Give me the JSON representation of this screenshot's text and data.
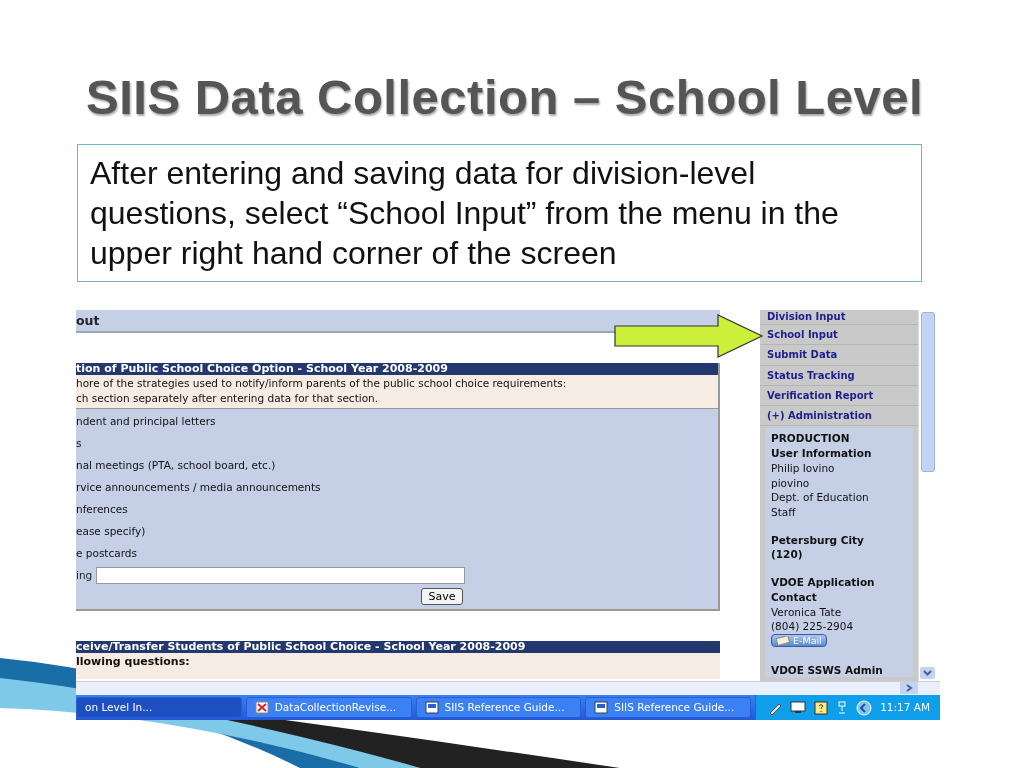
{
  "slide": {
    "title": "SIIS Data Collection – School Level",
    "callout": "After entering and saving data for division-level questions, select “School Input” from the menu in the upper right hand corner of the screen"
  },
  "screenshot": {
    "page_header": "out",
    "sections": [
      {
        "title": "tion of Public School Choice Option - School Year 2008-2009",
        "instructions": [
          "hore of the strategies used to notify/inform parents of the public school choice requirements:",
          "ch section separately after entering data for that section."
        ],
        "options": [
          "ndent and principal letters",
          "s",
          "nal meetings (PTA, school board, etc.)",
          "rvice announcements / media announcements",
          "nferences",
          "ease specify)",
          "e postcards"
        ],
        "field": {
          "label": "ing"
        },
        "button": "Save"
      },
      {
        "title": "ceive/Transfer Students of Public School Choice - School Year 2008-2009",
        "instructions": [
          "llowing questions:"
        ]
      }
    ],
    "menu": [
      "Division Input",
      "School Input",
      "Submit Data",
      "Status Tracking",
      "Verification Report",
      "(+) Administration"
    ],
    "info_blocks": [
      {
        "lines": [
          {
            "text": "PRODUCTION",
            "kind": "bold"
          },
          {
            "text": "User Information",
            "kind": "bold"
          },
          {
            "text": "Philip Iovino",
            "kind": "plain"
          },
          {
            "text": "piovino",
            "kind": "plain"
          },
          {
            "text": "Dept. of Education",
            "kind": "plain"
          },
          {
            "text": "Staff",
            "kind": "plain"
          }
        ]
      },
      {
        "lines": [
          {
            "text": "Petersburg City",
            "kind": "bold"
          },
          {
            "text": "(120)",
            "kind": "bold"
          }
        ]
      },
      {
        "lines": [
          {
            "text": "VDOE Application",
            "kind": "bold"
          },
          {
            "text": "Contact",
            "kind": "bold"
          },
          {
            "text": "Veronica Tate",
            "kind": "plain"
          },
          {
            "text": "(804) 225-2904",
            "kind": "plain"
          }
        ],
        "button": "E-Mail"
      },
      {
        "lines": [
          {
            "text": "VDOE SSWS Admin",
            "kind": "bold"
          }
        ]
      }
    ],
    "taskbar": {
      "buttons": [
        {
          "label": "on Level In...",
          "selected": true,
          "kind": "none"
        },
        {
          "label": "DataCollectionRevise...",
          "selected": false,
          "kind": "pdf"
        },
        {
          "label": "SIIS Reference Guide...",
          "selected": false,
          "kind": "doc"
        },
        {
          "label": "SIIS Reference Guide...",
          "selected": false,
          "kind": "doc"
        }
      ],
      "clock": "11:17 AM"
    }
  }
}
